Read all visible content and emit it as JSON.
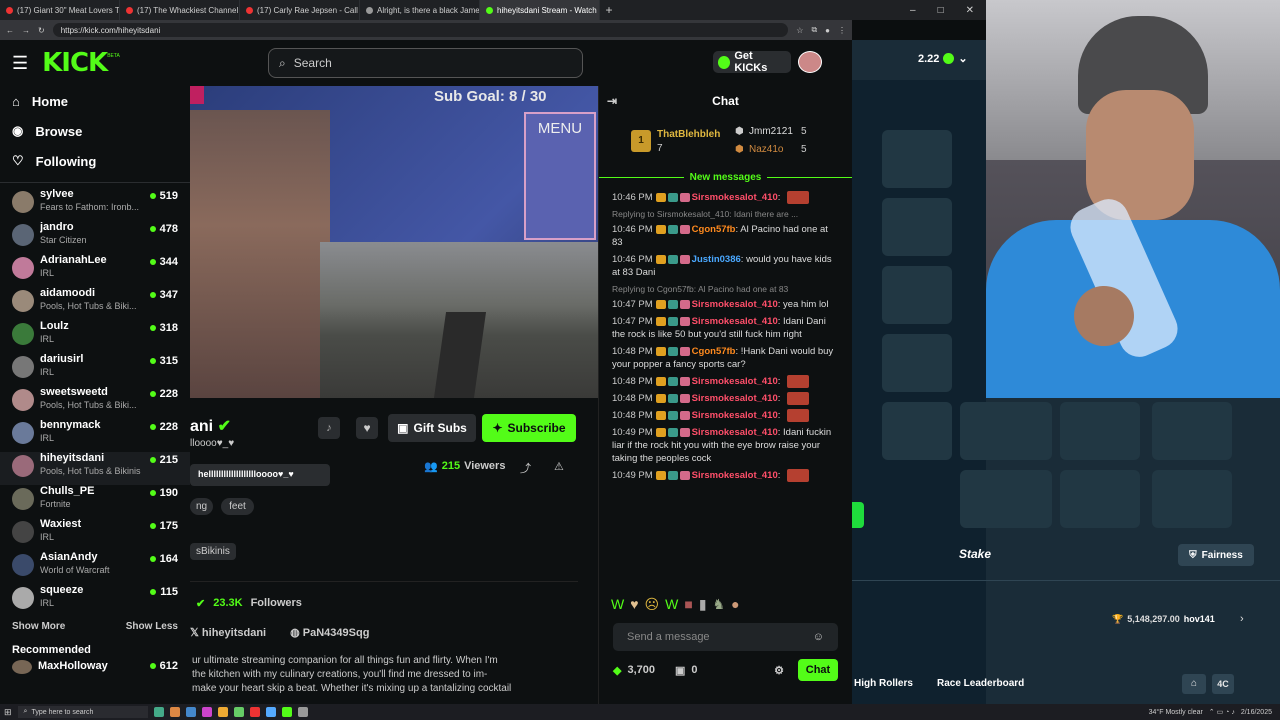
{
  "browser": {
    "tabs": [
      {
        "label": "(17) Giant 30\" Meat Lovers Team ..."
      },
      {
        "label": "(17) The Whackiest Channel on Yo..."
      },
      {
        "label": "(17) Carly Rae Jepsen - Call Me M..."
      },
      {
        "label": "Alright, is there a black James Bon..."
      },
      {
        "label": "hiheyitsdani Stream - Watch ..."
      }
    ],
    "url": "https://kick.com/hiheyitsdani"
  },
  "header": {
    "logo": "KICK",
    "beta": "BETA",
    "search_placeholder": "Search",
    "get_kicks": "Get KICKs"
  },
  "sidebar": {
    "nav": [
      {
        "label": "Home",
        "icon": "home-icon"
      },
      {
        "label": "Browse",
        "icon": "compass-icon"
      },
      {
        "label": "Following",
        "icon": "heart-icon"
      }
    ],
    "channels": [
      {
        "name": "sylvee",
        "category": "Fears to Fathom: Ironb...",
        "viewers": "519",
        "color": "#8a7b6a"
      },
      {
        "name": "jandro",
        "category": "Star Citizen",
        "viewers": "478",
        "color": "#5a6575"
      },
      {
        "name": "AdrianahLee",
        "category": "IRL",
        "viewers": "344",
        "color": "#c07a9a"
      },
      {
        "name": "aidamoodi",
        "category": "Pools, Hot Tubs & Biki...",
        "viewers": "347",
        "color": "#9a8a7a"
      },
      {
        "name": "Loulz",
        "category": "IRL",
        "viewers": "318",
        "color": "#3a7a3a"
      },
      {
        "name": "dariusirl",
        "category": "IRL",
        "viewers": "315",
        "color": "#777"
      },
      {
        "name": "sweetsweetd",
        "category": "Pools, Hot Tubs & Biki...",
        "viewers": "228",
        "color": "#b08a8a"
      },
      {
        "name": "bennymack",
        "category": "IRL",
        "viewers": "228",
        "color": "#6a7a9a"
      },
      {
        "name": "hiheyitsdani",
        "category": "Pools, Hot Tubs & Bikinis",
        "viewers": "215",
        "color": "#9a6a7a"
      },
      {
        "name": "Chulls_PE",
        "category": "Fortnite",
        "viewers": "190",
        "color": "#6a6a5a"
      },
      {
        "name": "Waxiest",
        "category": "IRL",
        "viewers": "175",
        "color": "#444"
      },
      {
        "name": "AsianAndy",
        "category": "World of Warcraft",
        "viewers": "164",
        "color": "#3a4a6a"
      },
      {
        "name": "squeeze",
        "category": "IRL",
        "viewers": "115",
        "color": "#aaa"
      }
    ],
    "show_more": "Show More",
    "show_less": "Show Less",
    "recommended": "Recommended",
    "rec_channel": {
      "name": "MaxHolloway",
      "viewers": "612"
    }
  },
  "stream": {
    "overlay_goal": "Sub Goal:  8 / 30",
    "menu": "MENU",
    "name_partial": "ani",
    "bio_partial": "lloooo♥_♥",
    "tooltip": "hellllllllllllllllllloooo♥_♥",
    "gift_subs": "Gift Subs",
    "subscribe": "Subscribe",
    "viewers": "215",
    "viewers_label": "Viewers",
    "tags": [
      "ng",
      "feet"
    ],
    "category_partial": "sBikinis",
    "followers": "23.3K",
    "followers_label": "Followers",
    "socials": [
      {
        "label": "hiheyitsdani",
        "icon": "x-icon"
      },
      {
        "label": "PaN4349Sqg",
        "icon": "discord-icon"
      }
    ],
    "about_lines": [
      "ur ultimate streaming companion for all things fun and flirty. When I'm",
      "the kitchen with my culinary creations, you'll find me dressed to im-",
      "make your heart skip a beat. Whether it's mixing up a tantalizing cocktail"
    ]
  },
  "chat": {
    "title": "Chat",
    "leaders": [
      {
        "name": "ThatBlehbleh",
        "count": "7"
      },
      {
        "name": "Jmm2121",
        "count": "5"
      },
      {
        "name": "Naz41o",
        "count": "5"
      }
    ],
    "new_messages": "New messages",
    "messages": [
      {
        "time": "10:46 PM",
        "user": "Sirsmokesalot_410",
        "color": "#ff4f6a",
        "text": ""
      },
      {
        "reply": "Replying to Sirsmokesalot_410: Idani there are ...",
        "time": "10:46 PM",
        "user": "Cgon57fb",
        "color": "#ff8a1e",
        "text": "Al Pacino had one at 83"
      },
      {
        "time": "10:46 PM",
        "user": "Justin0386",
        "color": "#4aa8ff",
        "text": "would you have kids at 83 Dani"
      },
      {
        "reply": "Replying to Cgon57fb: Al Pacino had one at 83",
        "time": "10:47 PM",
        "user": "Sirsmokesalot_410",
        "color": "#ff4f6a",
        "text": "yea him lol"
      },
      {
        "time": "10:47 PM",
        "user": "Sirsmokesalot_410",
        "color": "#ff4f6a",
        "text": "Idani Dani the rock is like 50 but you'd still fuck him right"
      },
      {
        "time": "10:48 PM",
        "user": "Cgon57fb",
        "color": "#ff8a1e",
        "text": "!Hank Dani would buy your popper a fancy sports car?"
      },
      {
        "time": "10:48 PM",
        "user": "Sirsmokesalot_410",
        "color": "#ff4f6a",
        "text": ""
      },
      {
        "time": "10:48 PM",
        "user": "Sirsmokesalot_410",
        "color": "#ff4f6a",
        "text": ""
      },
      {
        "time": "10:48 PM",
        "user": "Sirsmokesalot_410",
        "color": "#ff4f6a",
        "text": ""
      },
      {
        "time": "10:49 PM",
        "user": "Sirsmokesalot_410",
        "color": "#ff4f6a",
        "text": "Idani fuckin liar if the rock hit you with the eye brow raise your taking the peoples cock"
      },
      {
        "time": "10:49 PM",
        "user": "Sirsmokesalot_410",
        "color": "#ff4f6a",
        "text": ""
      }
    ],
    "input_placeholder": "Send a message",
    "points": "3,700",
    "gifts": "0",
    "send": "Chat"
  },
  "stake": {
    "balance": "2.22",
    "logo": "Stake",
    "fairness": "Fairness",
    "prize": "5,148,297.00",
    "prize_user": "hov141",
    "tabs": [
      "High Rollers",
      "Race Leaderboard"
    ],
    "badge_partial": "4C"
  },
  "taskbar": {
    "search": "Type here to search",
    "weather": "34°F  Mostly clear",
    "time": "",
    "date": "2/16/2025"
  }
}
